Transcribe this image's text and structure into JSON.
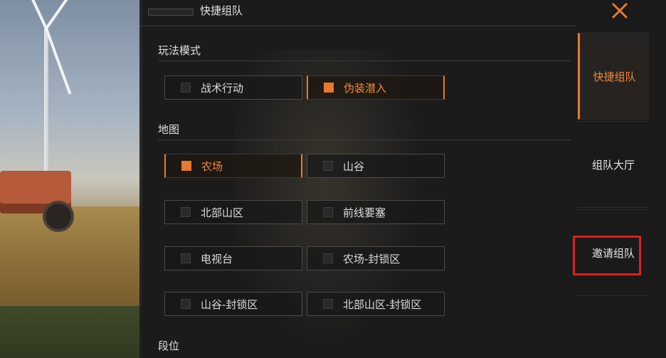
{
  "header": {
    "title": "快捷组队"
  },
  "sections": {
    "mode": {
      "label": "玩法模式",
      "options": [
        {
          "label": "战术行动",
          "selected": false
        },
        {
          "label": "伪装潜入",
          "selected": true
        }
      ]
    },
    "map": {
      "label": "地图",
      "options": [
        {
          "label": "农场",
          "selected": true
        },
        {
          "label": "山谷",
          "selected": false
        },
        {
          "label": "北部山区",
          "selected": false
        },
        {
          "label": "前线要塞",
          "selected": false
        },
        {
          "label": "电视台",
          "selected": false
        },
        {
          "label": "农场-封锁区",
          "selected": false
        },
        {
          "label": "山谷-封锁区",
          "selected": false
        },
        {
          "label": "北部山区-封锁区",
          "selected": false
        }
      ]
    },
    "rank": {
      "label": "段位"
    }
  },
  "side_tabs": [
    {
      "label": "快捷组队",
      "active": true
    },
    {
      "label": "组队大厅",
      "active": false
    },
    {
      "label": "邀请组队",
      "active": false
    }
  ],
  "icons": {
    "close": "close-icon"
  },
  "colors": {
    "accent": "#e87a2e",
    "highlight": "#e01e1e"
  }
}
